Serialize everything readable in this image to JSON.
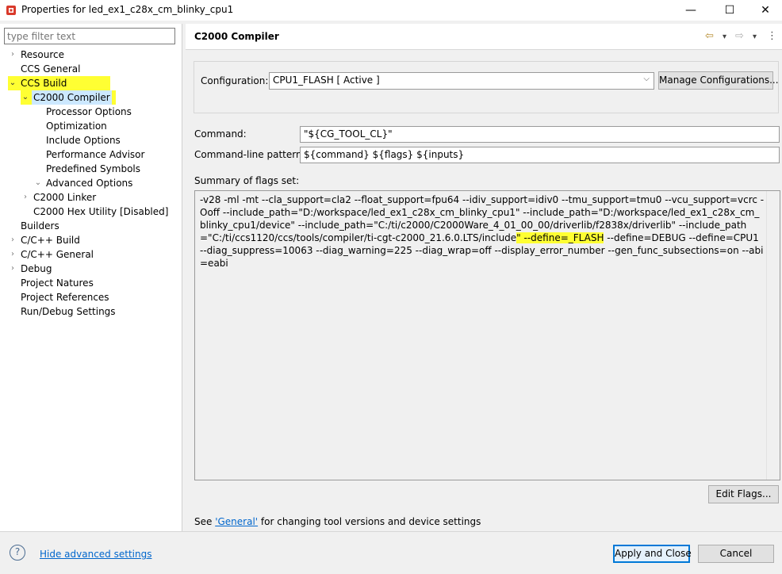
{
  "window": {
    "title": "Properties for led_ex1_c28x_cm_blinky_cpu1",
    "icon": "code-composer-icon",
    "minimize": "—",
    "maximize": "☐",
    "close": "✕"
  },
  "filter": {
    "placeholder": "type filter text"
  },
  "tree": {
    "items": [
      {
        "label": "Resource",
        "twisty": "›",
        "highlighted": false
      },
      {
        "label": "CCS General",
        "twisty": "",
        "highlighted": false
      },
      {
        "label": "CCS Build",
        "twisty": "⌄",
        "highlighted": true
      },
      {
        "label": "C2000 Compiler",
        "twisty": "⌄",
        "highlighted": true
      },
      {
        "label": "Processor Options"
      },
      {
        "label": "Optimization"
      },
      {
        "label": "Include Options"
      },
      {
        "label": "Performance Advisor"
      },
      {
        "label": "Predefined Symbols"
      },
      {
        "label": "Advanced Options",
        "twisty": "⌄"
      },
      {
        "label": "C2000 Linker",
        "twisty": "›"
      },
      {
        "label": "C2000 Hex Utility  [Disabled]"
      },
      {
        "label": "Builders"
      },
      {
        "label": "C/C++ Build",
        "twisty": "›"
      },
      {
        "label": "C/C++ General",
        "twisty": "›"
      },
      {
        "label": "Debug",
        "twisty": "›"
      },
      {
        "label": "Project Natures"
      },
      {
        "label": "Project References"
      },
      {
        "label": "Run/Debug Settings"
      }
    ]
  },
  "page": {
    "title": "C2000 Compiler",
    "nav": {
      "back": "⇦",
      "back_menu": "▾",
      "forward": "⇨",
      "forward_menu": "▾",
      "more": "⋮"
    },
    "configuration_label": "Configuration:",
    "configuration_value": "CPU1_FLASH  [ Active ]",
    "manage_button": "Manage Configurations...",
    "command_label": "Command:",
    "command_value": "\"${CG_TOOL_CL}\"",
    "pattern_label": "Command-line pattern:",
    "pattern_value": "${command} ${flags} ${inputs}",
    "summary_label": "Summary of flags set:",
    "summary_before": "-v28 -ml -mt --cla_support=cla2 --float_support=fpu64 --idiv_support=idiv0 --tmu_support=tmu0 --vcu_support=vcrc -Ooff --include_path=\"D:/workspace/led_ex1_c28x_cm_blinky_cpu1\" --include_path=\"D:/workspace/led_ex1_c28x_cm_blinky_cpu1/device\" --include_path=\"C:/ti/c2000/C2000Ware_4_01_00_00/driverlib/f2838x/driverlib\" --include_path=\"C:/ti/ccs1120/ccs/tools/compiler/ti-cgt-c2000_21.6.0.LTS/include",
    "summary_highlight": "\" --define=_FLASH",
    "summary_after": " --define=DEBUG --define=CPU1 --diag_suppress=10063 --diag_warning=225 --diag_wrap=off --display_error_number --gen_func_subsections=on --abi=eabi",
    "edit_flags": "Edit Flags...",
    "footer_see": "See ",
    "footer_link": "'General'",
    "footer_rest": " for changing tool versions and device settings"
  },
  "bottom": {
    "help": "?",
    "hide_advanced": "Hide advanced settings",
    "apply_close": "Apply and Close",
    "cancel": "Cancel"
  },
  "colors": {
    "highlight": "#ffff33",
    "link": "#0066cc",
    "accent": "#0078d7"
  }
}
